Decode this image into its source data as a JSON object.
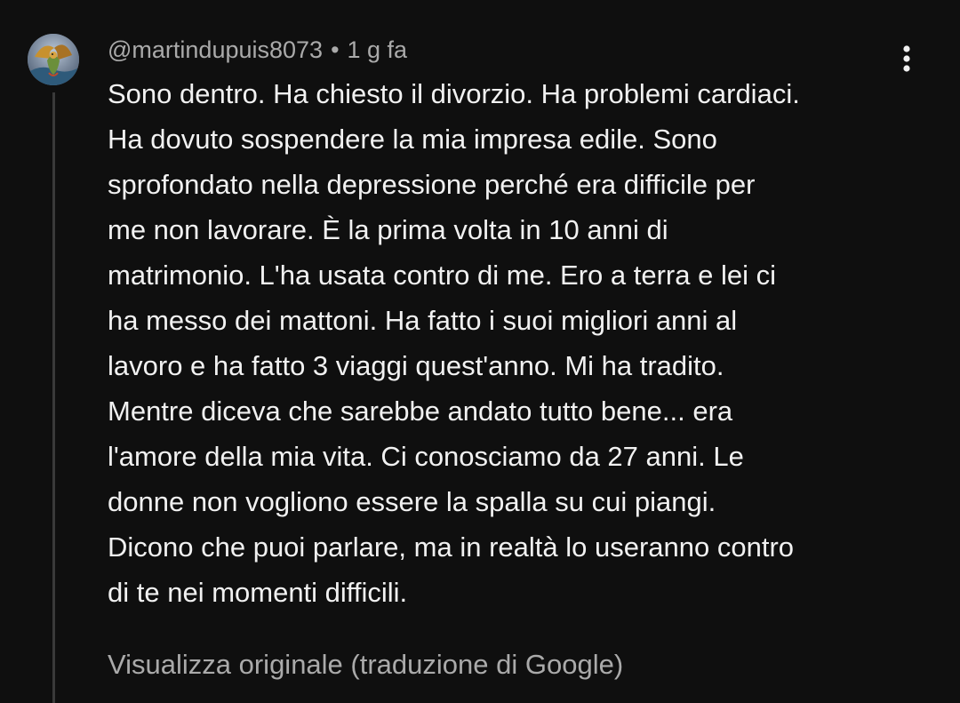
{
  "comment": {
    "author": "@martindupuis8073",
    "separator": "•",
    "timestamp": "1 g fa",
    "menu_icon": "more-vert-icon",
    "avatar_icon": "dragon-avatar",
    "text": "Sono dentro. Ha chiesto il divorzio. Ha problemi cardiaci.\nHa dovuto sospendere la mia impresa edile. Sono\nsprofondato nella depressione perché era difficile per\nme non lavorare. È la prima volta in 10 anni di\nmatrimonio. L'ha usata contro di me. Ero a terra e lei ci\nha messo dei mattoni. Ha fatto i suoi migliori anni al\nlavoro e ha fatto 3 viaggi quest'anno. Mi ha tradito.\nMentre diceva che sarebbe andato tutto bene... era\nl'amore della mia vita. Ci conosciamo da 27 anni. Le\ndonne non vogliono essere la spalla su cui piangi.\nDicono che puoi parlare, ma in realtà lo useranno contro\ndi te nei momenti difficili.",
    "translate_label": "Visualizza originale (traduzione di Google)"
  },
  "colors": {
    "background": "#0f0f0f",
    "primary_text": "#f1f1f1",
    "secondary_text": "#aaaaaa",
    "thread_line": "#3a3a3a"
  }
}
